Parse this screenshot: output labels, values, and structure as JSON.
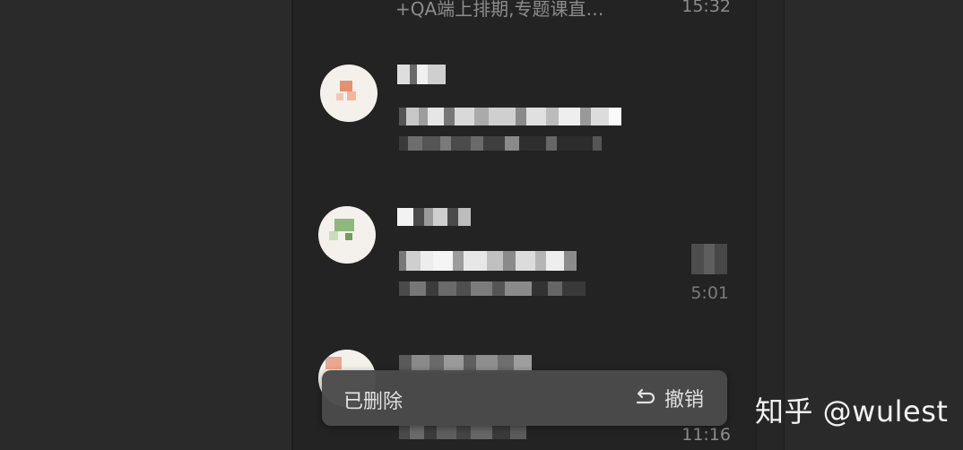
{
  "conversations": [
    {
      "preview": "+QA端上排期,专题课直…",
      "time": "15:32",
      "avatar_icon": "contact-avatar-icon"
    },
    {
      "preview": "",
      "time": "",
      "avatar_icon": "contact-avatar-icon"
    },
    {
      "preview": "",
      "time": "5:01",
      "avatar_icon": "group-avatar-icon"
    },
    {
      "preview": "",
      "time": "11:16",
      "avatar_icon": "contact-avatar-icon"
    }
  ],
  "toast": {
    "message": "已删除",
    "action_label": "撤销",
    "action_icon": "undo-icon"
  },
  "watermark": {
    "text": "知乎 @wulest"
  },
  "colors": {
    "background": "#2a2a2a",
    "list_background": "#232323",
    "toast_background": "#4b4b4b",
    "secondary_text": "#8c8c8c",
    "primary_text": "#e8e8e8"
  }
}
